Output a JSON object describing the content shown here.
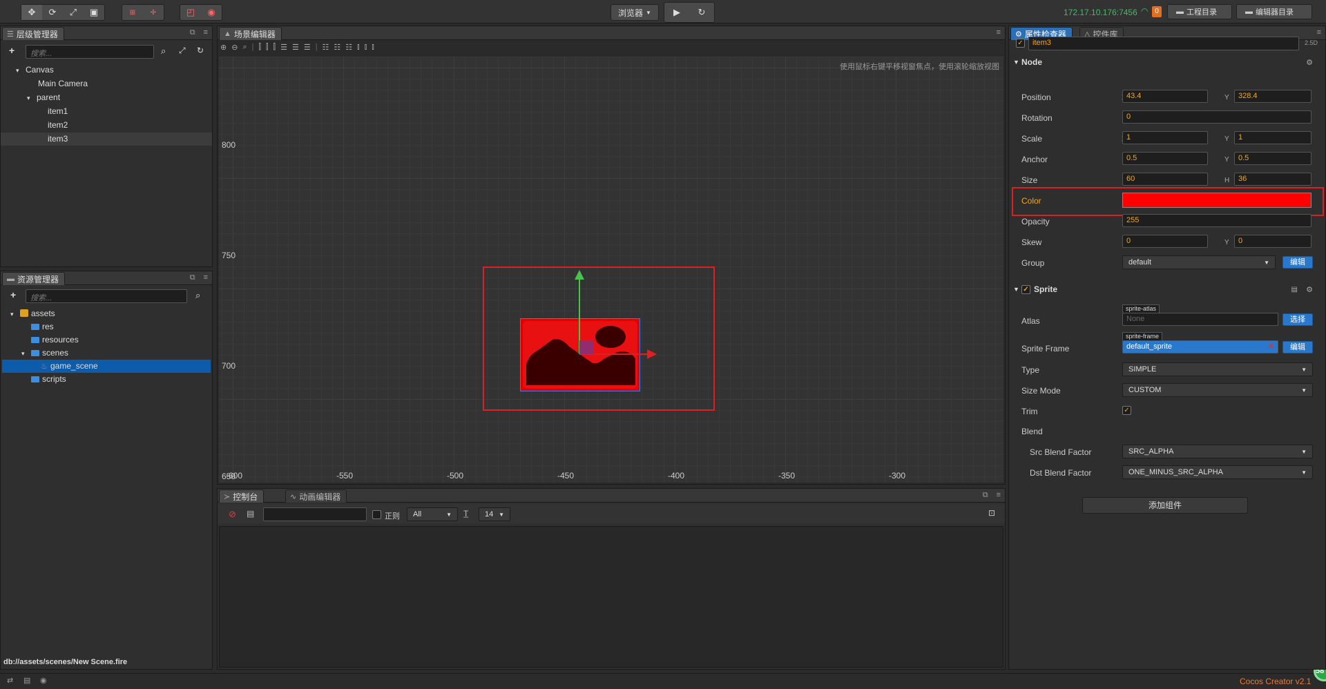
{
  "toolbar": {
    "transform_tools": [
      "move-icon",
      "rotate-icon",
      "scale-icon",
      "rect-icon"
    ],
    "gizmo_tools": [
      "local-icon",
      "pivot-icon"
    ],
    "snap_tools": [
      "snap-icon",
      "global-icon"
    ],
    "preview_select": "浏览器",
    "ip_address": "172.17.10.176:7456",
    "wifi_badge": "0",
    "project_dir_label": "工程目录",
    "editor_dir_label": "编辑器目录"
  },
  "hierarchy": {
    "title": "层级管理器",
    "search_placeholder": "搜索...",
    "items": [
      {
        "label": "Canvas",
        "depth": 0,
        "arrow": "▾"
      },
      {
        "label": "Main Camera",
        "depth": 1,
        "arrow": ""
      },
      {
        "label": "parent",
        "depth": 1,
        "arrow": "▾"
      },
      {
        "label": "item1",
        "depth": 2,
        "arrow": ""
      },
      {
        "label": "item2",
        "depth": 2,
        "arrow": ""
      },
      {
        "label": "item3",
        "depth": 2,
        "arrow": ""
      }
    ]
  },
  "assets": {
    "title": "资源管理器",
    "search_placeholder": "搜索...",
    "items": [
      {
        "label": "assets",
        "depth": 0,
        "arrow": "▾"
      },
      {
        "label": "res",
        "depth": 1,
        "arrow": ""
      },
      {
        "label": "resources",
        "depth": 1,
        "arrow": ""
      },
      {
        "label": "scenes",
        "depth": 1,
        "arrow": "▾"
      },
      {
        "label": "game_scene",
        "depth": 2,
        "arrow": ""
      },
      {
        "label": "scripts",
        "depth": 1,
        "arrow": ""
      }
    ],
    "status_path": "db://assets/scenes/New Scene.fire"
  },
  "scene": {
    "title": "场景编辑器",
    "hint": "使用鼠标右键平移视窗焦点，使用滚轮缩放视图",
    "y_labels": [
      "800",
      "750",
      "700",
      "650"
    ],
    "x_labels": [
      "-600",
      "-550",
      "-500",
      "-450",
      "-400",
      "-350",
      "-300"
    ]
  },
  "console": {
    "tab_console": "控制台",
    "tab_animation": "动画编辑器",
    "regex_label": "正则",
    "level_select": "All",
    "font_size_select": "14"
  },
  "inspector": {
    "tab_inspector": "属性检查器",
    "tab_widgets": "控件库",
    "mode_label": "2.5D",
    "node_name": "item3",
    "node_section": "Node",
    "position": {
      "label": "Position",
      "x": "43.4",
      "y": "328.4"
    },
    "rotation": {
      "label": "Rotation",
      "value": "0"
    },
    "scale": {
      "label": "Scale",
      "x": "1",
      "y": "1"
    },
    "anchor": {
      "label": "Anchor",
      "x": "0.5",
      "y": "0.5"
    },
    "size": {
      "label": "Size",
      "w": "60",
      "h": "36"
    },
    "color": {
      "label": "Color",
      "value": "#ff0000"
    },
    "opacity": {
      "label": "Opacity",
      "value": "255"
    },
    "skew": {
      "label": "Skew",
      "x": "0",
      "y": "0"
    },
    "group": {
      "label": "Group",
      "value": "default",
      "edit_label": "编辑"
    },
    "sprite_section": "Sprite",
    "atlas": {
      "label": "Atlas",
      "tag": "sprite-atlas",
      "value": "None",
      "button": "选择"
    },
    "sprite_frame": {
      "label": "Sprite Frame",
      "tag": "sprite-frame",
      "value": "default_sprite",
      "button": "编辑"
    },
    "type": {
      "label": "Type",
      "value": "SIMPLE"
    },
    "size_mode": {
      "label": "Size Mode",
      "value": "CUSTOM"
    },
    "trim": {
      "label": "Trim"
    },
    "blend": {
      "label": "Blend"
    },
    "src_blend": {
      "label": "Src Blend Factor",
      "value": "SRC_ALPHA"
    },
    "dst_blend": {
      "label": "Dst Blend Factor",
      "value": "ONE_MINUS_SRC_ALPHA"
    },
    "add_component": "添加组件"
  },
  "status_bar": {
    "version": "Cocos Creator v2.1",
    "fps": "58"
  },
  "colors": {
    "accent": "#2d6fb6",
    "highlight_red": "#e02020",
    "value_orange": "#f5a623"
  }
}
